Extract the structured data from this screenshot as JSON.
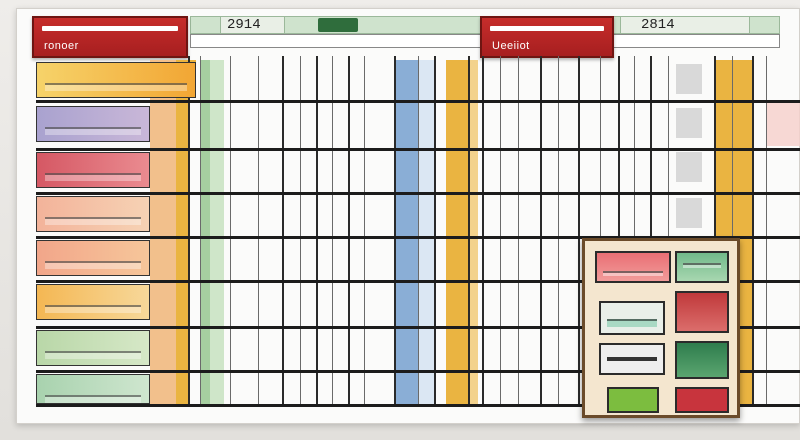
{
  "panels": {
    "left_title": "ronoer",
    "right_title": "Ueeiiot"
  },
  "tabs": {
    "left_number": "2914",
    "right_number": "2814"
  },
  "colors": {
    "header_red": "#b4282a",
    "column_yellow": "#eab441",
    "column_blue": "#8aaed6",
    "column_green": "#a6cfa0"
  },
  "row_icons": [
    "yellow-label-icon",
    "purple-label-icon",
    "red-label-icon",
    "peach-label-icon",
    "orange-label-icon",
    "amber-label-icon",
    "green-label-icon",
    "mint-label-icon"
  ],
  "popup_icons": [
    "red-swatch-icon",
    "green-swatch-icon",
    "mint-swatch-icon",
    "maroon-swatch-icon",
    "gray-swatch-icon",
    "darkgreen-swatch-icon",
    "lime-swatch-icon",
    "crimson-swatch-icon"
  ]
}
